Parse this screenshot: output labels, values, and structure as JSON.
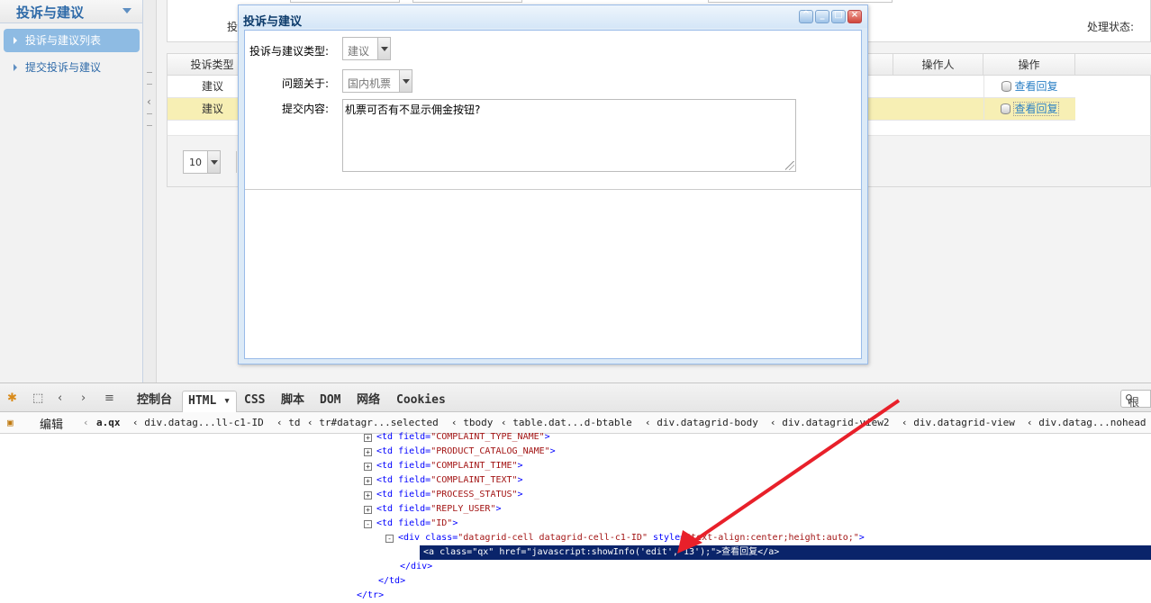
{
  "sidebar": {
    "header": "投诉与建议",
    "items": [
      {
        "label": "投诉与建议列表",
        "selected": true
      },
      {
        "label": "提交投诉与建议",
        "selected": false
      }
    ]
  },
  "search": {
    "label_left": "投",
    "status_label": "处理状态:"
  },
  "grid": {
    "headers": {
      "type": "投诉类型",
      "operator": "操作人",
      "action": "操作"
    },
    "rows": [
      {
        "type": "建议",
        "action": "查看回复",
        "selected": false
      },
      {
        "type": "建议",
        "action": "查看回复",
        "selected": true
      }
    ]
  },
  "pager": {
    "page_size": "10"
  },
  "dialog": {
    "title": "投诉与建议",
    "type_label": "投诉与建议类型:",
    "type_value": "建议",
    "about_label": "问题关于:",
    "about_value": "国内机票",
    "content_label": "提交内容:",
    "content_value": "机票可否有不显示佣金按钮?"
  },
  "firebug": {
    "tabs": [
      "控制台",
      "HTML",
      "CSS",
      "脚本",
      "DOM",
      "网络",
      "Cookies"
    ],
    "active_tab": "HTML",
    "edit_label": "编辑",
    "search_hint": "根",
    "path": [
      "a.qx",
      "div.datag...ll-c1-ID",
      "td",
      "tr#datagr...selected",
      "tbody",
      "table.dat...d-btable",
      "div.datagrid-body",
      "div.datagrid-view2",
      "div.datagrid-view",
      "div.datag...nohead"
    ],
    "tree": [
      {
        "pm": "+",
        "tag": "<td",
        "attr": "field=",
        "val": "\"COMPLAINT_TYPE_NAME\"",
        "end": ">"
      },
      {
        "pm": "+",
        "tag": "<td",
        "attr": "field=",
        "val": "\"PRODUCT_CATALOG_NAME\"",
        "end": ">"
      },
      {
        "pm": "+",
        "tag": "<td",
        "attr": "field=",
        "val": "\"COMPLAINT_TIME\"",
        "end": ">"
      },
      {
        "pm": "+",
        "tag": "<td",
        "attr": "field=",
        "val": "\"COMPLAINT_TEXT\"",
        "end": ">"
      },
      {
        "pm": "+",
        "tag": "<td",
        "attr": "field=",
        "val": "\"PROCESS_STATUS\"",
        "end": ">"
      },
      {
        "pm": "+",
        "tag": "<td",
        "attr": "field=",
        "val": "\"REPLY_USER\"",
        "end": ">"
      },
      {
        "pm": "-",
        "tag": "<td",
        "attr": "field=",
        "val": "\"ID\"",
        "end": ">"
      },
      {
        "pm": "-",
        "tag": "<div",
        "attr": "class=",
        "val": "\"datagrid-cell datagrid-cell-c1-ID\"",
        "attr2": "style=",
        "val2": "\"text-align:center;height:auto;\"",
        "end": ">"
      },
      {
        "pm": "",
        "tag": "<a",
        "attr": "class=",
        "val": "\"qx\"",
        "attr2": "href=",
        "val2": "\"javascript:showInfo('edit','13');\"",
        "end": ">查看回复</a>"
      },
      {
        "pm": "",
        "tag": "</div>",
        "attr": "",
        "val": "",
        "end": ""
      },
      {
        "pm": "",
        "tag": "</td>",
        "attr": "",
        "val": "",
        "end": ""
      },
      {
        "pm": "",
        "tag": "</tr>",
        "attr": "",
        "val": "",
        "end": ""
      }
    ]
  },
  "annotation": {
    "color": "#e8202a"
  }
}
